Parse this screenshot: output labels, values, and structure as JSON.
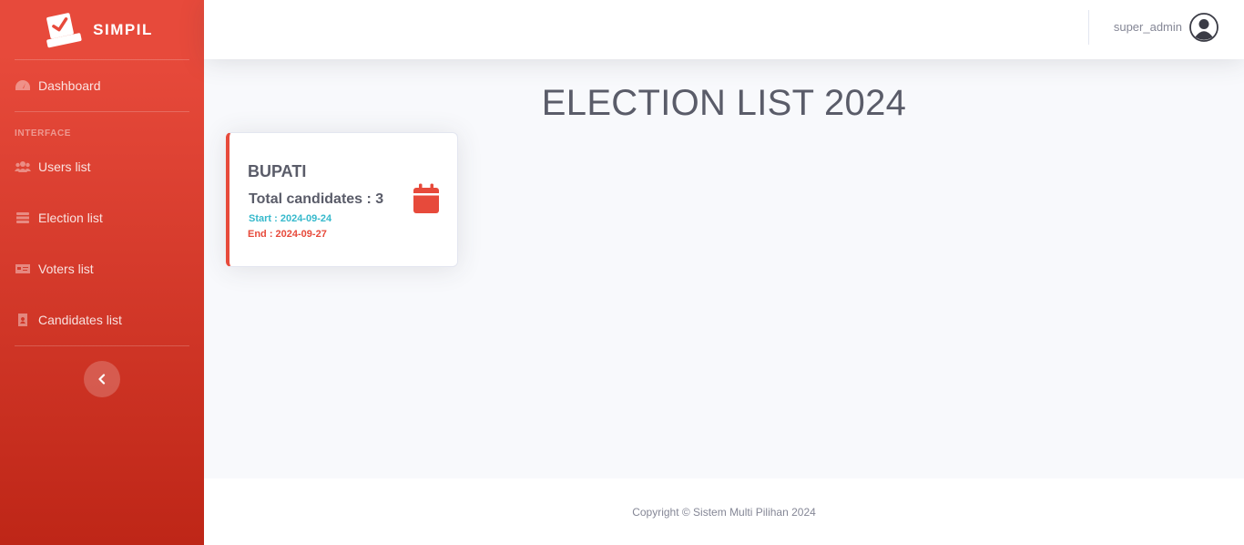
{
  "brand": {
    "name": "SIMPIL",
    "logo_icon": "ballot-box-check-icon"
  },
  "sidebar": {
    "dashboard": {
      "label": "Dashboard",
      "icon": "tachometer-icon"
    },
    "heading": "INTERFACE",
    "items": [
      {
        "label": "Users list",
        "icon": "users-icon"
      },
      {
        "label": "Election list",
        "icon": "list-table-icon"
      },
      {
        "label": "Voters list",
        "icon": "id-card-icon"
      },
      {
        "label": "Candidates list",
        "icon": "address-book-icon"
      }
    ],
    "toggle_icon": "chevron-left-icon"
  },
  "topbar": {
    "username": "super_admin",
    "avatar_icon": "user-circle-icon"
  },
  "main": {
    "title": "ELECTION LIST 2024",
    "elections": [
      {
        "name": "BUPATI",
        "total_candidates": "Total candidates : 3",
        "start": "Start : 2024-09-24",
        "end": "End : 2024-09-27",
        "icon": "calendar-icon"
      }
    ]
  },
  "footer": {
    "copyright": "Copyright © Sistem Multi Pilihan 2024"
  },
  "colors": {
    "primary": "#e74a3b",
    "primary_dark": "#be2617",
    "info": "#36b9cc",
    "text": "#5a5c69",
    "muted": "#858796"
  }
}
